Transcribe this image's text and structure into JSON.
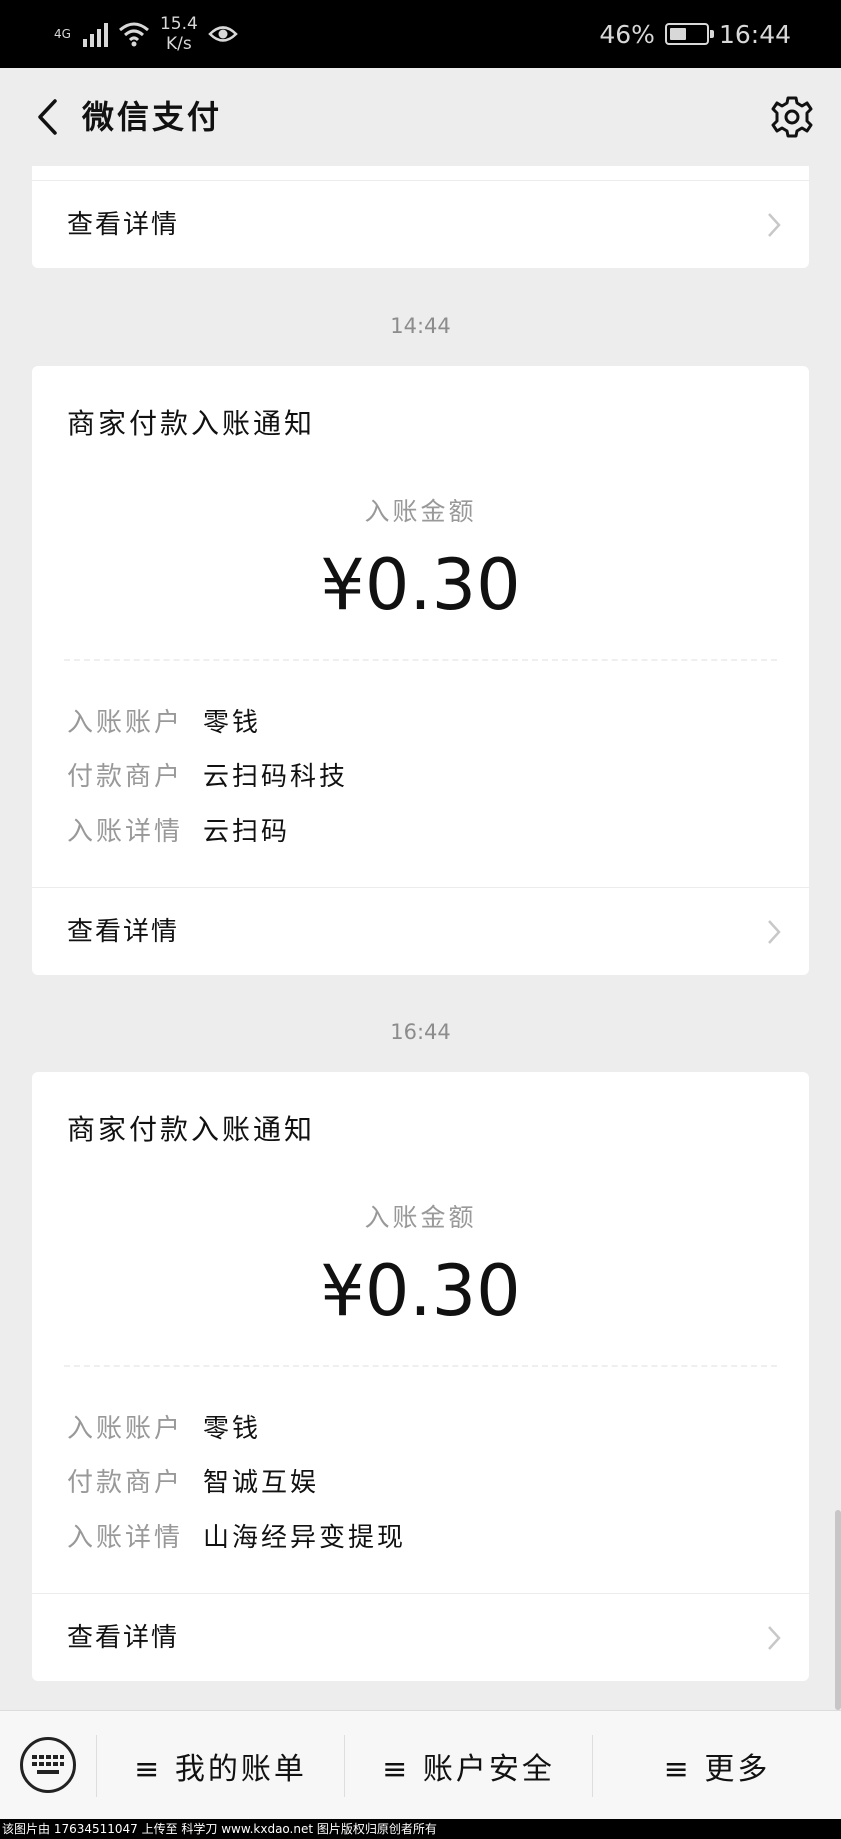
{
  "status_bar": {
    "network": "4G",
    "speed_value": "15.4",
    "speed_unit": "K/s",
    "battery_percent": "46%",
    "battery_level": 0.46,
    "time": "16:44"
  },
  "header": {
    "title": "微信支付"
  },
  "partial_card": {
    "detail_label": "查看详情"
  },
  "messages": [
    {
      "time": "14:44",
      "title": "商家付款入账通知",
      "amount_label": "入账金额",
      "amount": "¥0.30",
      "fields": [
        {
          "key": "入账账户",
          "value": "零钱"
        },
        {
          "key": "付款商户",
          "value": "云扫码科技"
        },
        {
          "key": "入账详情",
          "value": "云扫码"
        }
      ],
      "detail_label": "查看详情"
    },
    {
      "time": "16:44",
      "title": "商家付款入账通知",
      "amount_label": "入账金额",
      "amount": "¥0.30",
      "fields": [
        {
          "key": "入账账户",
          "value": "零钱"
        },
        {
          "key": "付款商户",
          "value": "智诚互娱"
        },
        {
          "key": "入账详情",
          "value": "山海经异变提现"
        }
      ],
      "detail_label": "查看详情"
    }
  ],
  "bottom_menu": [
    {
      "label": "≡ 我的账单"
    },
    {
      "label": "≡ 账户安全"
    },
    {
      "label": "≡ 更多"
    }
  ],
  "watermark": "该图片由 17634511047 上传至 科学刀 www.kxdao.net 图片版权归原创者所有"
}
